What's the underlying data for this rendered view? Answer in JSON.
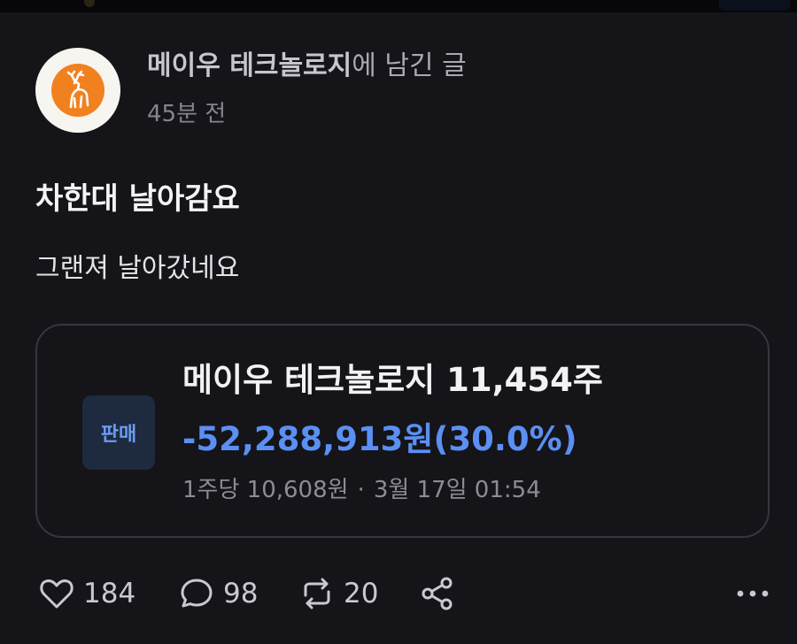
{
  "post": {
    "author_name": "메이우 테크놀로지",
    "author_suffix": "에 남긴 글",
    "time_ago": "45분 전",
    "title": "차한대 날아감요",
    "body": "그랜져 날아갔네요"
  },
  "trade": {
    "badge": "판매",
    "stock_line": "메이우 테크놀로지 11,454주",
    "pnl_line": "-52,288,913원(30.0%)",
    "price_per_share": "1주당 10,608원",
    "separator": "·",
    "datetime": "3월 17일 01:54"
  },
  "actions": {
    "likes": "184",
    "comments": "98",
    "reposts": "20"
  },
  "icons": {
    "like": "heart-icon",
    "comment": "comment-icon",
    "repost": "repost-icon",
    "share": "share-icon",
    "more": "more-icon"
  },
  "colors": {
    "background": "#141419",
    "loss_blue": "#5b8ff2",
    "badge_bg": "#1e2a40",
    "avatar_orange": "#f1811f"
  }
}
